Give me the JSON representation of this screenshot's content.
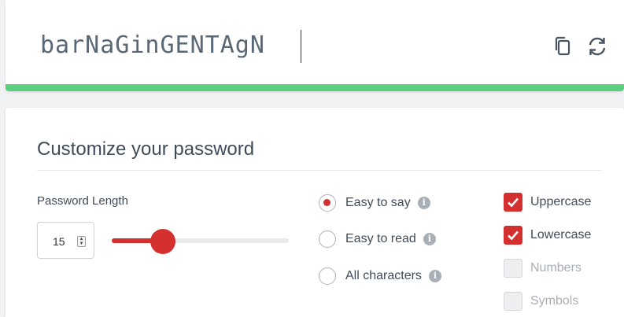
{
  "generator": {
    "password": "barNaGinGENTAgN",
    "strength": "strong",
    "strength_color": "#5ad07f",
    "copy_icon": "copy-icon",
    "refresh_icon": "refresh-icon"
  },
  "options": {
    "title": "Customize your password",
    "length": {
      "label": "Password Length",
      "value": "15",
      "slider_fraction": 0.29
    },
    "modes": [
      {
        "label": "Easy to say",
        "selected": true
      },
      {
        "label": "Easy to read",
        "selected": false
      },
      {
        "label": "All characters",
        "selected": false
      }
    ],
    "info_icon_glyph": "i",
    "characters": [
      {
        "label": "Uppercase",
        "checked": true,
        "enabled": true
      },
      {
        "label": "Lowercase",
        "checked": true,
        "enabled": true
      },
      {
        "label": "Numbers",
        "checked": false,
        "enabled": false
      },
      {
        "label": "Symbols",
        "checked": false,
        "enabled": false
      }
    ],
    "accent_color": "#d3302f"
  }
}
